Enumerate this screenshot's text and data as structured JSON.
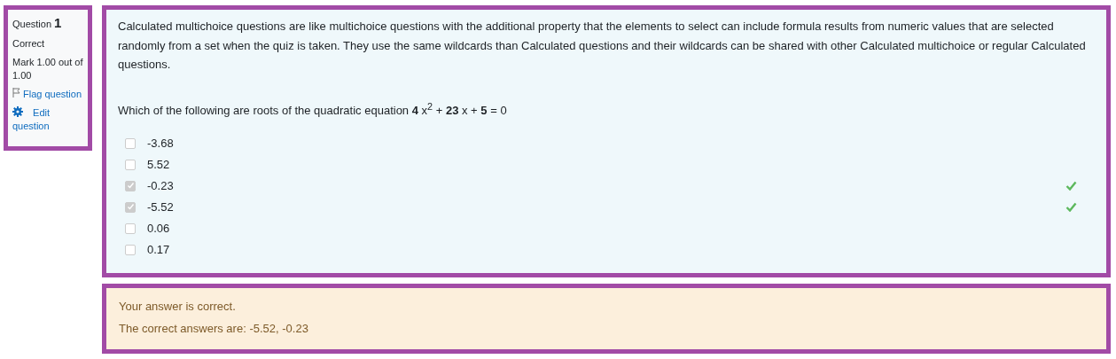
{
  "info": {
    "label": "Question",
    "number": "1",
    "state": "Correct",
    "mark": "Mark 1.00 out of 1.00",
    "flag": "Flag question",
    "edit": "Edit question"
  },
  "question": {
    "intro": "Calculated multichoice questions are like multichoice questions with the additional property that the elements to select can include formula results from numeric values that are selected randomly from a set when the quiz is taken. They use the same wildcards than Calculated questions and their wildcards can be shared with other Calculated multichoice or regular Calculated questions.",
    "prompt": "Which of the following are roots of the quadratic equation **4** x$^{2}$ + **23** x + **5** = 0",
    "options": [
      {
        "label": "-3.68",
        "checked": false,
        "correct": false
      },
      {
        "label": "5.52",
        "checked": false,
        "correct": false
      },
      {
        "label": "-0.23",
        "checked": true,
        "correct": true
      },
      {
        "label": "-5.52",
        "checked": true,
        "correct": true
      },
      {
        "label": "0.06",
        "checked": false,
        "correct": false
      },
      {
        "label": "0.17",
        "checked": false,
        "correct": false
      }
    ]
  },
  "feedback": [
    "Your answer is correct.",
    "The correct answers are: -5.52, -0.23"
  ]
}
